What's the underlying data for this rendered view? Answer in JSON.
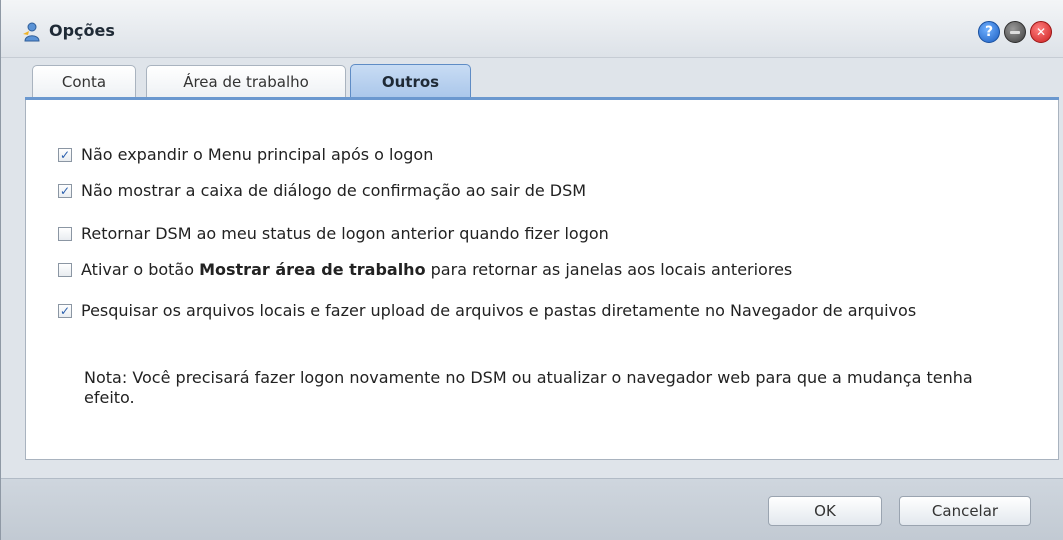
{
  "window": {
    "title": "Opções",
    "icon": "options-person-icon",
    "buttons": {
      "help": "?",
      "minimize": "",
      "close": "✕"
    }
  },
  "tabs": [
    {
      "label": "Conta",
      "active": false
    },
    {
      "label": "Área de trabalho",
      "active": false
    },
    {
      "label": "Outros",
      "active": true
    }
  ],
  "options": [
    {
      "checked": true,
      "label": "Não expandir o Menu principal após o logon"
    },
    {
      "checked": true,
      "label": "Não mostrar a caixa de diálogo de confirmação ao sair de DSM"
    },
    {
      "checked": false,
      "label": "Retornar DSM ao meu status de logon anterior quando fizer logon"
    },
    {
      "checked": false,
      "label_prefix": "Ativar o botão ",
      "label_bold": "Mostrar área de trabalho",
      "label_suffix": " para retornar as janelas aos locais anteriores"
    },
    {
      "checked": true,
      "label": "Pesquisar os arquivos locais e fazer upload de arquivos e pastas diretamente no Navegador de arquivos"
    }
  ],
  "note": "Nota: Você precisará fazer logon novamente no DSM ou atualizar o navegador web para que a mudança tenha efeito.",
  "footer": {
    "ok_label": "OK",
    "cancel_label": "Cancelar"
  },
  "colors": {
    "accent": "#6b98cf",
    "check": "#2a5fae",
    "close": "#cc1f1f",
    "help": "#1d5fc2"
  }
}
